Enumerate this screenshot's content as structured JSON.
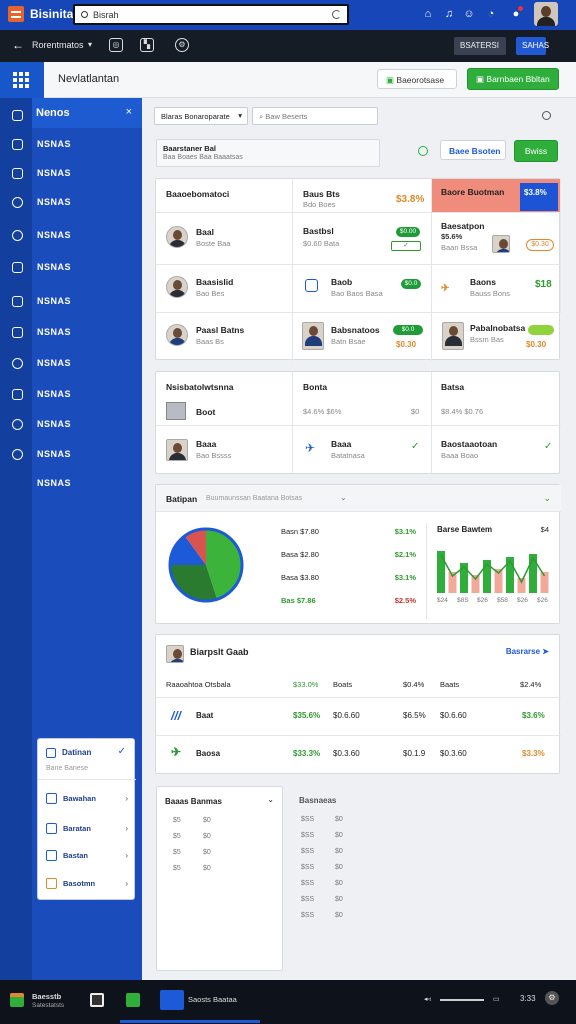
{
  "app": {
    "brand": "Bisinita",
    "search_placeholder": "Bisrah"
  },
  "toolbar": {
    "crumb": "Rorentmatos",
    "chip1": "BSATERSI",
    "chip2": "SAHAS"
  },
  "title": {
    "text": "Nevlatlantan",
    "btn_secondary": "Baeorotsase",
    "btn_primary": "Barnbaen Bbltan"
  },
  "sidebar": {
    "header": "Nenos",
    "items": [
      "NSNAS",
      "NSNAS",
      "NSNAS",
      "NSNAS",
      "NSNAS",
      "NSNAS",
      "NSNAS",
      "NSNAS",
      "NSNAS",
      "NSNAS",
      "NSNAS",
      "NSNAS"
    ],
    "minicard": {
      "title": "Datinan",
      "subtitle": "Bane Banese",
      "rows": [
        "Bawahan",
        "Baratan",
        "Bastan",
        "Basotmn"
      ]
    }
  },
  "filters": {
    "dropdown": "Blaras Bonaroparate",
    "search_placeholder": "Baw Beserts"
  },
  "notice": {
    "line1": "Baarstaner  Bal",
    "line2": "Baa Boaes  Baa Baaatsas",
    "btn_outline": "Baee Bsoten",
    "btn_green": "Bwiss"
  },
  "grid1": {
    "header": {
      "c1": "Baaoebomatoci",
      "c2": "Baus Bts",
      "c2sub": "Bdo Boes",
      "c2val": "$3.8%",
      "c3": "Baore Buotman",
      "c3val": "$3.8%"
    },
    "rows": [
      {
        "c1name": "Baal",
        "c1sub": "Boste  Baa",
        "c2name": "Bastbsl",
        "c2sub": "$0.60  Bata",
        "c2pill": "$0.00",
        "c3name": "Baesatpon",
        "c3sub": "$5.6%",
        "c3sub2": "Baan  Bssa",
        "c3val": "$0.30"
      },
      {
        "c1name": "Baasislid",
        "c1sub": "Bao  Bes",
        "c2name": "Baob",
        "c2sub": "Bao  Baos  Basa",
        "c2pill": "$0.0",
        "c3name": "Baons",
        "c3sub": "Bauss Bons",
        "c3val": "$18"
      },
      {
        "c1name": "Paasl Batns",
        "c1sub": "Baas  Bs",
        "c2name": "Babsnatoos",
        "c2sub": "Batn  Bsae",
        "c2pill": "$0.0",
        "c3name": "Pabalnobatsa",
        "c3sub": "Bssm Bas",
        "c3val": "$0.30"
      }
    ]
  },
  "grid2": {
    "header": {
      "c1": "Nsisbatolwtsnna",
      "c2": "Bonta",
      "c2sub": "$4.6%  $6%",
      "c3": "Batsa",
      "c3sub": "$8.4%  $0.76"
    },
    "rows": [
      {
        "c1name": "Boot",
        "c2val": "$0"
      },
      {
        "c1name": "Baaa",
        "c1sub": "Bao  Bssss",
        "c2name": "Baaa",
        "c2sub": "Batatnasa",
        "c3name": "Baostaaotoan",
        "c3sub": "Baaa Boao"
      }
    ]
  },
  "chart": {
    "title": "Batipan",
    "subtitle": "Buumaunssan  Baatana  Botsas",
    "legend_rows": [
      {
        "label": "Basn $7.80",
        "pct": "$3.1%"
      },
      {
        "label": "Basa $2.80",
        "pct": "$2.1%"
      },
      {
        "label": "Basa $3.80",
        "pct": "$3.1%"
      },
      {
        "label": "Bas $7.86",
        "pct": "$2.5%"
      }
    ],
    "right_title": "Barse Bawtem",
    "right_val": "$4",
    "xlabels": [
      "$24",
      "$8S",
      "$26",
      "$58",
      "$26",
      "$26"
    ]
  },
  "chart_data": {
    "type": "pie",
    "categories": [
      "Basn $7.80",
      "Basa $2.80",
      "Basa $3.80",
      "Bas $7.86"
    ],
    "values": [
      45,
      30,
      15,
      10
    ],
    "title": "Batipan",
    "bar_values": [
      28,
      14,
      20,
      12,
      22,
      16,
      24,
      10,
      26,
      14
    ],
    "bar_categories": [
      "$24",
      "$8S",
      "$26",
      "$58",
      "$26",
      "$26"
    ]
  },
  "deposit": {
    "title": "Biarpslt Gaab",
    "link": "Basrarse",
    "header": [
      "Raaoahtoa Otsbala",
      "$33.0%",
      "Boats",
      "$0.4%",
      "Baats",
      "$2.4%"
    ],
    "rows": [
      {
        "name": "Baat",
        "v1": "$35.6%",
        "v2": "$0.6.60",
        "v3": "$6.5%",
        "v4": "$0.6.60",
        "v5": "$3.6%"
      },
      {
        "name": "Baosa",
        "v1": "$33.3%",
        "v2": "$0.3.60",
        "v3": "$0.1.9",
        "v4": "$0.3.60",
        "v5": "$3.3%"
      }
    ]
  },
  "bottom": {
    "left_title": "Baaas Banmas",
    "left_rows": [
      [
        "$5",
        "$0"
      ],
      [
        "$5",
        "$0"
      ],
      [
        "$5",
        "$0"
      ],
      [
        "$5",
        "$0"
      ]
    ],
    "right_title": "Basnaeas",
    "right_rows": [
      [
        "$SS",
        "$0"
      ],
      [
        "$SS",
        "$0"
      ],
      [
        "$SS",
        "$0"
      ],
      [
        "$SS",
        "$0"
      ],
      [
        "$SS",
        "$0"
      ],
      [
        "$SS",
        "$0"
      ],
      [
        "$SS",
        "$0"
      ]
    ]
  },
  "taskbar": {
    "app1": "Baesstb",
    "app1sub": "Satestatsts",
    "active_app": "Saosts Baataa",
    "time": "3:33"
  },
  "colors": {
    "blue": "#1a4cbc",
    "green": "#2fae3c",
    "red": "#c4352b",
    "orange": "#e0892a"
  }
}
